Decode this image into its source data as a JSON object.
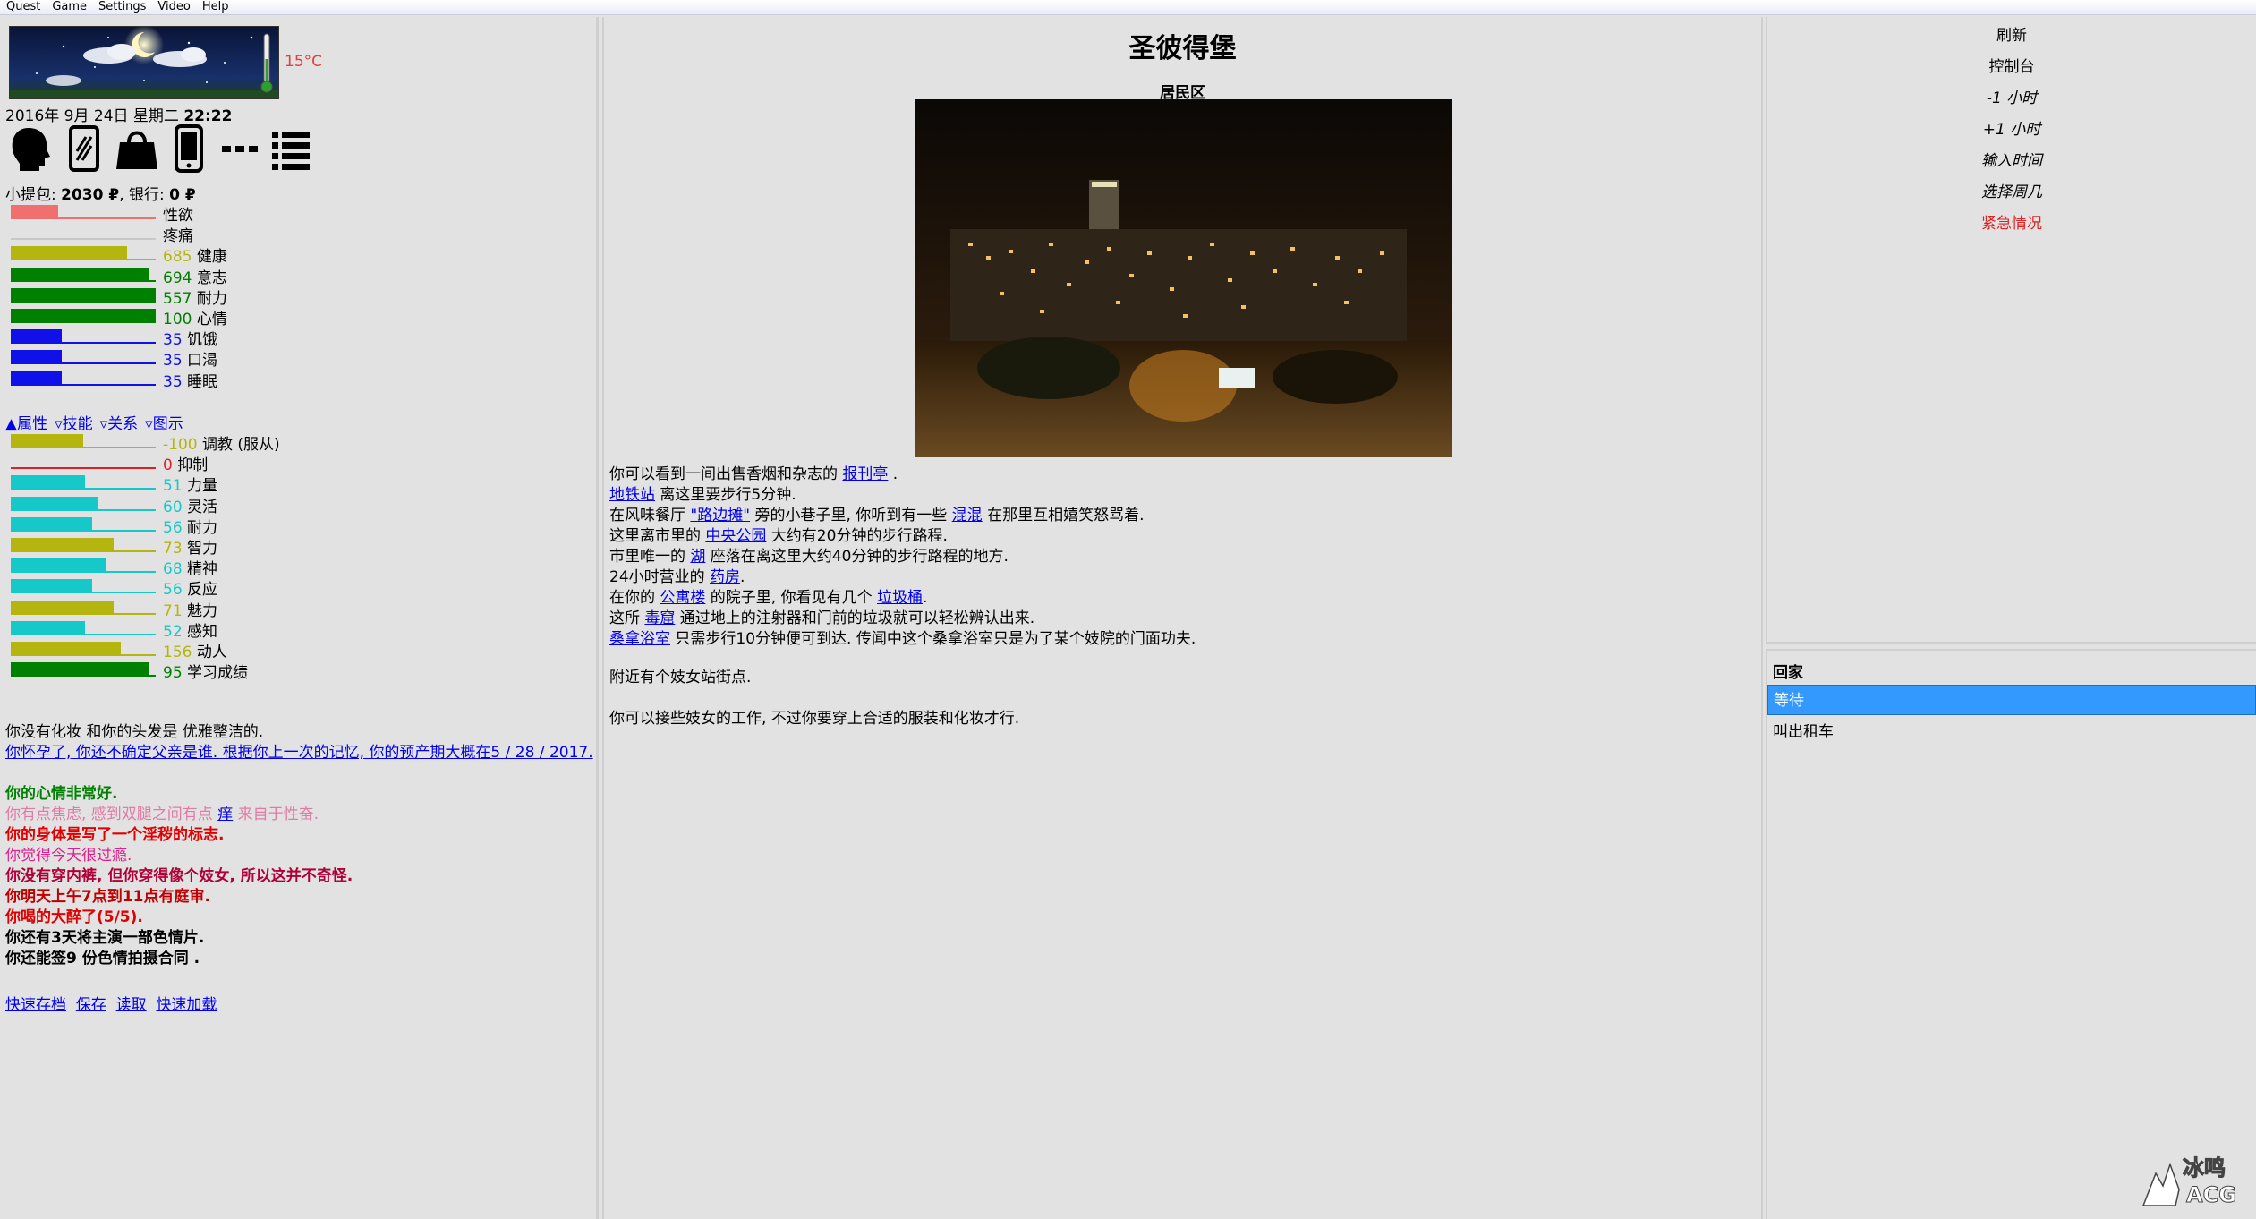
{
  "menu": [
    "Quest",
    "Game",
    "Settings",
    "Video",
    "Help"
  ],
  "left": {
    "temperature": "15°C",
    "date": "2016年 9月 24日 星期二",
    "time": "22:22",
    "icon_names": [
      "head-profile-icon",
      "mirror-icon",
      "handbag-icon",
      "phone-icon",
      "more-dots-icon",
      "list-icon"
    ],
    "money": {
      "wallet_label": "小提包: ",
      "wallet": "2030 ₽",
      "bank_label": ", 银行: ",
      "bank": "0 ₽"
    },
    "stats": [
      {
        "value": "",
        "label": "性欲",
        "pct": 0.33,
        "color": "#f07070",
        "line": "#f07070",
        "numcolor": "#000"
      },
      {
        "value": "",
        "label": "疼痛",
        "pct": 0.0,
        "color": "#c0c0c0",
        "line": "#c8c8c8",
        "numcolor": "#000"
      },
      {
        "value": "685",
        "label": "健康",
        "pct": 0.8,
        "color": "#b5b50f",
        "line": "#b5b50f",
        "numcolor": "#b5b50f"
      },
      {
        "value": "694",
        "label": "意志",
        "pct": 0.95,
        "color": "#008000",
        "line": "#008000",
        "numcolor": "#008000"
      },
      {
        "value": "557",
        "label": "耐力",
        "pct": 1.0,
        "color": "#008000",
        "line": "#008000",
        "numcolor": "#008000"
      },
      {
        "value": "100",
        "label": "心情",
        "pct": 1.0,
        "color": "#008000",
        "line": "#008000",
        "numcolor": "#008000"
      },
      {
        "value": "35",
        "label": "饥饿",
        "pct": 0.35,
        "color": "#1010e8",
        "line": "#1010e8",
        "numcolor": "#1010e8"
      },
      {
        "value": "35",
        "label": "口渴",
        "pct": 0.35,
        "color": "#1010e8",
        "line": "#1010e8",
        "numcolor": "#1010e8"
      },
      {
        "value": "35",
        "label": "睡眠",
        "pct": 0.35,
        "color": "#1010e8",
        "line": "#1010e8",
        "numcolor": "#1010e8"
      }
    ],
    "tabs": [
      "▲属性",
      "▿技能",
      "▿关系",
      "▿图示"
    ],
    "attributes": [
      {
        "value": "-100",
        "label": "调教 (服从)",
        "pct": 0.5,
        "color": "#b5b50f",
        "line": "#b5b50f",
        "numcolor": "#b5b50f"
      },
      {
        "value": "0",
        "label": "抑制",
        "pct": 0.0,
        "color": "#e02020",
        "line": "#e02020",
        "numcolor": "#e02020"
      },
      {
        "value": "51",
        "label": "力量",
        "pct": 0.51,
        "color": "#16c8c8",
        "line": "#16c8c8",
        "numcolor": "#16c8c8"
      },
      {
        "value": "60",
        "label": "灵活",
        "pct": 0.6,
        "color": "#16c8c8",
        "line": "#16c8c8",
        "numcolor": "#16c8c8"
      },
      {
        "value": "56",
        "label": "耐力",
        "pct": 0.56,
        "color": "#16c8c8",
        "line": "#16c8c8",
        "numcolor": "#16c8c8"
      },
      {
        "value": "73",
        "label": "智力",
        "pct": 0.71,
        "color": "#b5b50f",
        "line": "#b5b50f",
        "numcolor": "#b5b50f"
      },
      {
        "value": "68",
        "label": "精神",
        "pct": 0.66,
        "color": "#16c8c8",
        "line": "#16c8c8",
        "numcolor": "#16c8c8"
      },
      {
        "value": "56",
        "label": "反应",
        "pct": 0.56,
        "color": "#16c8c8",
        "line": "#16c8c8",
        "numcolor": "#16c8c8"
      },
      {
        "value": "71",
        "label": "魅力",
        "pct": 0.71,
        "color": "#b5b50f",
        "line": "#b5b50f",
        "numcolor": "#b5b50f"
      },
      {
        "value": "52",
        "label": "感知",
        "pct": 0.51,
        "color": "#16c8c8",
        "line": "#16c8c8",
        "numcolor": "#16c8c8"
      },
      {
        "value": "156",
        "label": "动人",
        "pct": 0.76,
        "color": "#b5b50f",
        "line": "#b5b50f",
        "numcolor": "#b5b50f"
      },
      {
        "value": "95",
        "label": "学习成绩",
        "pct": 0.95,
        "color": "#008000",
        "line": "#008000",
        "numcolor": "#008000"
      }
    ],
    "status_line": "你没有化妆 和你的头发是 优雅整洁的.",
    "pregnancy_line": "你怀孕了, 你还不确定父亲是谁. 根据你上一次的记忆, 你的预产期大概在5 / 28 / 2017.",
    "mood": "你的心情非常好.",
    "itch_pre": "你有点焦虑, 感到双腿之间有点 ",
    "itch_link": "痒",
    "itch_post": " 来自于性奋.",
    "mark": "你的身体是写了一个淫秽的标志.",
    "day_line": "你觉得今天很过瘾.",
    "underwear": "你没有穿内裤, 但你穿得像个妓女, 所以这并不奇怪.",
    "court": "你明天上午7点到11点有庭审.",
    "drunk": "你喝的大醉了(5/5).",
    "film": "你还有3天将主演一部色情片.",
    "contract": "你还能签9 份色情拍摄合同 .",
    "save_links": [
      "快速存档",
      "保存",
      "读取",
      "快速加载"
    ]
  },
  "center": {
    "title": "圣彼得堡",
    "subtitle": "居民区",
    "lines": [
      [
        {
          "t": "你可以看到一间出售香烟和杂志的 "
        },
        {
          "l": "报刊亭"
        },
        {
          "t": " ."
        }
      ],
      [
        {
          "l": "地铁站"
        },
        {
          "t": " 离这里要步行5分钟."
        }
      ],
      [
        {
          "t": "在风味餐厅 "
        },
        {
          "l": "\"路边摊\""
        },
        {
          "t": " 旁的小巷子里, 你听到有一些 "
        },
        {
          "l": "混混"
        },
        {
          "t": " 在那里互相嬉笑怒骂着."
        }
      ],
      [
        {
          "t": "这里离市里的 "
        },
        {
          "l": "中央公园"
        },
        {
          "t": " 大约有20分钟的步行路程."
        }
      ],
      [
        {
          "t": "市里唯一的 "
        },
        {
          "l": "湖"
        },
        {
          "t": " 座落在离这里大约40分钟的步行路程的地方."
        }
      ],
      [
        {
          "t": "24小时营业的 "
        },
        {
          "l": "药房"
        },
        {
          "t": "."
        }
      ],
      [
        {
          "t": "在你的 "
        },
        {
          "l": "公寓楼"
        },
        {
          "t": " 的院子里, 你看见有几个 "
        },
        {
          "l": "垃圾桶"
        },
        {
          "t": "."
        }
      ],
      [
        {
          "t": "这所 "
        },
        {
          "l": "毒窟"
        },
        {
          "t": " 通过地上的注射器和门前的垃圾就可以轻松辨认出来."
        }
      ],
      [
        {
          "l": "桑拿浴室"
        },
        {
          "t": " 只需步行10分钟便可到达. 传闻中这个桑拿浴室只是为了某个妓院的门面功夫."
        }
      ]
    ],
    "note1": "附近有个妓女站街点.",
    "note2": "你可以接些妓女的工作, 不过你要穿上合适的服装和化妆才行."
  },
  "right": {
    "controls": [
      "刷新",
      "控制台",
      "-1 小时",
      "+1 小时",
      "输入时间",
      "选择周几",
      "紧急情况"
    ],
    "home_header": "回家",
    "actions": [
      "等待",
      "叫出租车"
    ],
    "watermark": "冰鸣 ACG"
  }
}
